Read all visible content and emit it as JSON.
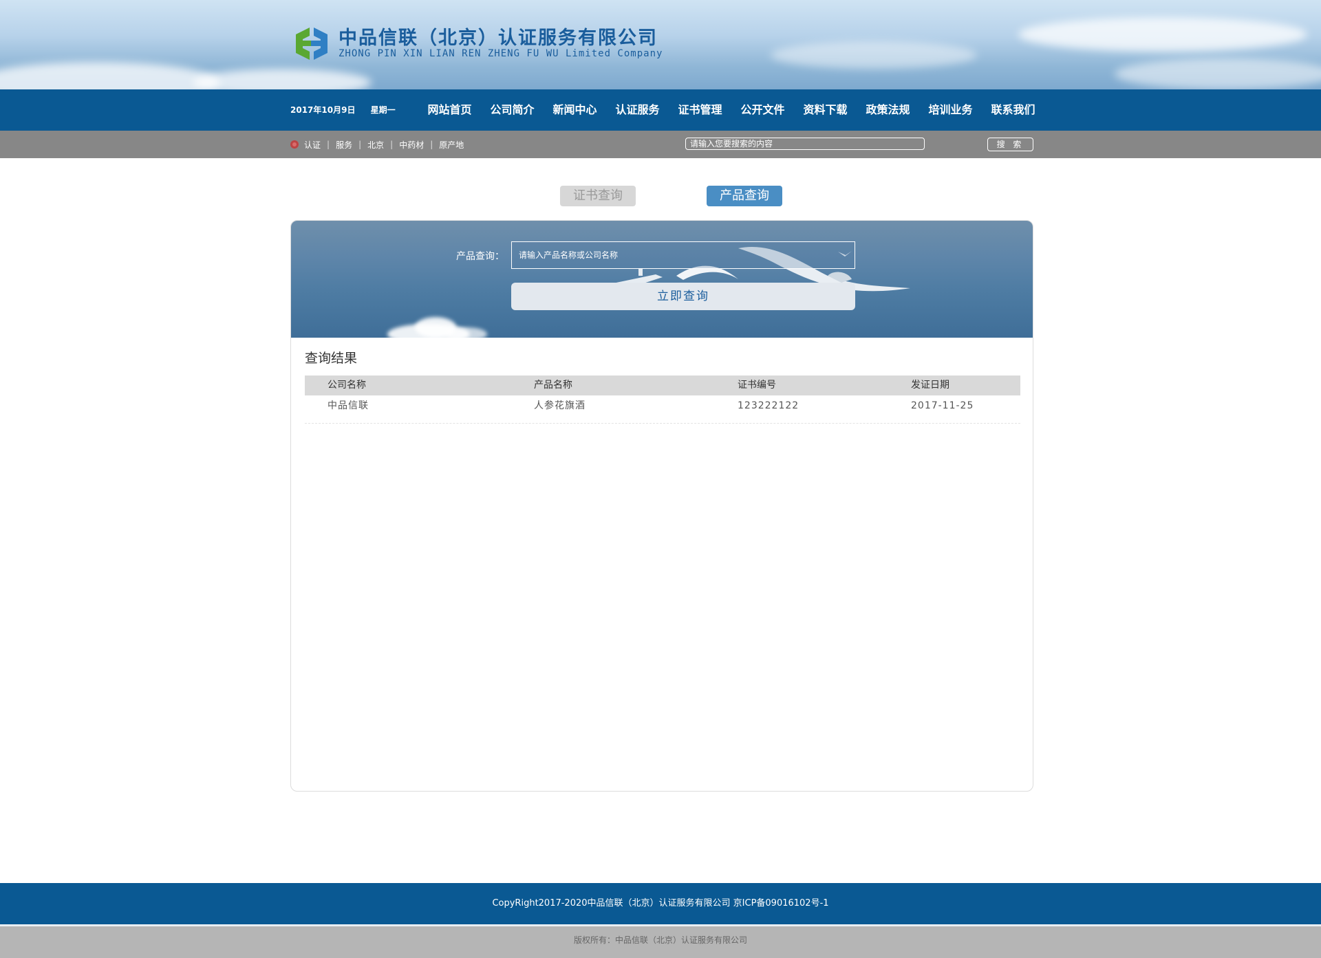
{
  "header": {
    "company_name_zh": "中品信联（北京）认证服务有限公司",
    "company_name_en": "ZHONG PIN XIN LIAN REN ZHENG FU WU Limited Company",
    "logo_icon": "company-logo-icon"
  },
  "nav": {
    "date": "2017年10月9日",
    "weekday": "星期一",
    "items": [
      {
        "label": "网站首页"
      },
      {
        "label": "公司简介"
      },
      {
        "label": "新闻中心"
      },
      {
        "label": "认证服务"
      },
      {
        "label": "证书管理"
      },
      {
        "label": "公开文件"
      },
      {
        "label": "资料下载"
      },
      {
        "label": "政策法规"
      },
      {
        "label": "培训业务"
      },
      {
        "label": "联系我们"
      }
    ]
  },
  "subbar": {
    "keywords": [
      "认证",
      "服务",
      "北京",
      "中药材",
      "原产地"
    ],
    "search_placeholder": "请输入您要搜索的内容",
    "search_button": "搜 索"
  },
  "tabs": {
    "cert_query": "证书查询",
    "product_query": "产品查询",
    "active": "product_query"
  },
  "query": {
    "label": "产品查询：",
    "placeholder": "请输入产品名称或公司名称",
    "submit": "立即查询"
  },
  "results": {
    "title": "查询结果",
    "columns": [
      "公司名称",
      "产品名称",
      "证书编号",
      "发证日期"
    ],
    "rows": [
      [
        "中品信联",
        "人参花旗酒",
        "123222122",
        "2017-11-25"
      ]
    ]
  },
  "footer": {
    "copyright": "CopyRight2017-2020中品信联（北京）认证服务有限公司 京ICP备09016102号-1",
    "rights": "版权所有：中品信联（北京）认证服务有限公司"
  },
  "colors": {
    "nav_bg": "#0a5993",
    "subbar_bg": "#878787",
    "active_tab": "#4a8ec4",
    "inactive_tab": "#d7d7d7"
  }
}
